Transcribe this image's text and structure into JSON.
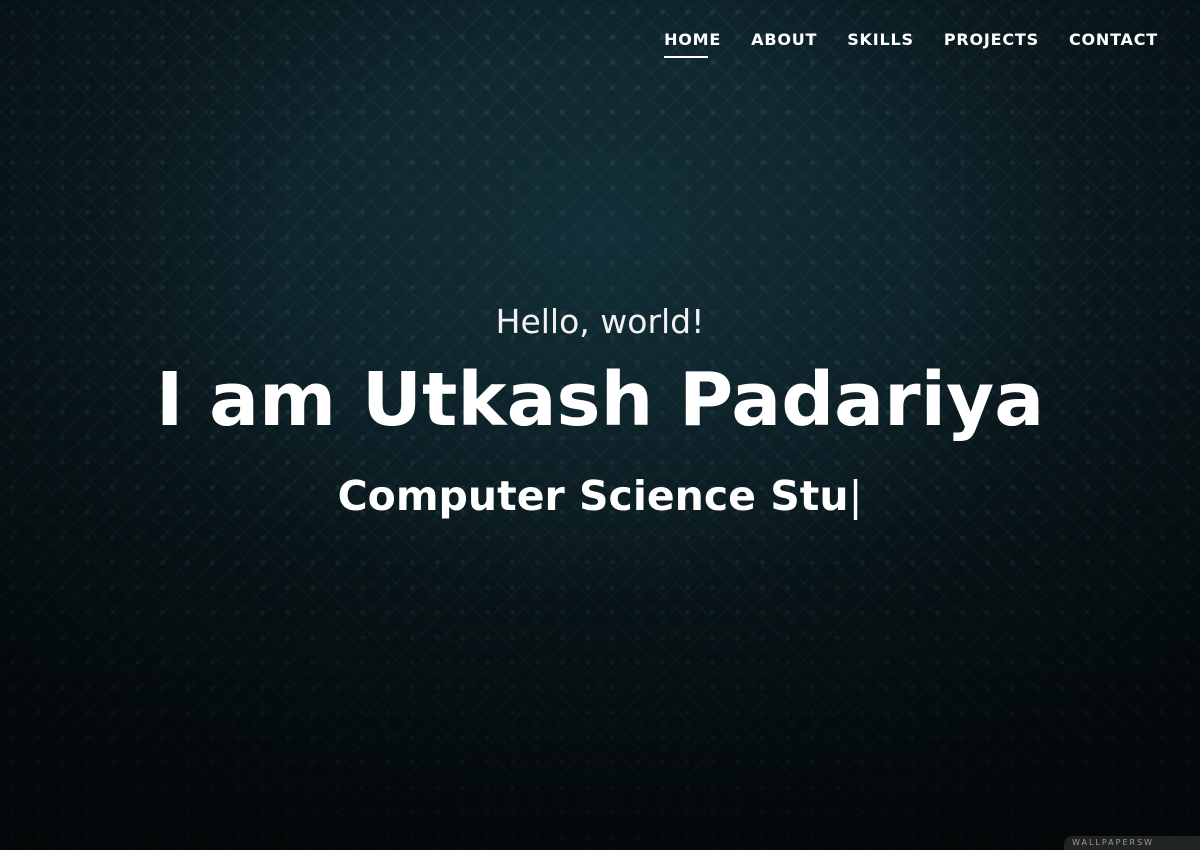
{
  "nav": {
    "items": [
      {
        "label": "HOME",
        "active": true
      },
      {
        "label": "ABOUT",
        "active": false
      },
      {
        "label": "SKILLS",
        "active": false
      },
      {
        "label": "PROJECTS",
        "active": false
      },
      {
        "label": "CONTACT",
        "active": false
      }
    ]
  },
  "hero": {
    "greeting": "Hello, world!",
    "name": "I am Utkash Padariya",
    "typed_text": "Computer Science Stu",
    "cursor": "|"
  },
  "watermark": {
    "text": "WALLPAPERSW"
  },
  "colors": {
    "background": "#0d2128",
    "text": "#ffffff",
    "underline": "#ffffff"
  }
}
